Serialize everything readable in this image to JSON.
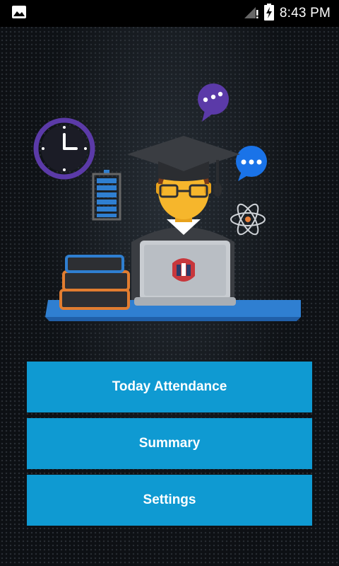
{
  "status_bar": {
    "time": "8:43 PM",
    "icons": [
      "image-notification-icon",
      "signal-icon",
      "battery-charging-icon"
    ]
  },
  "illustration": {
    "icons": [
      "clock-icon",
      "chat-bubble-icon",
      "battery-icon",
      "atom-icon",
      "graduate-icon",
      "laptop-icon",
      "books-icon"
    ],
    "colors": {
      "purple": "#5b3aa8",
      "blue": "#1a73e8",
      "desk": "#2f7fd1",
      "skin": "#f6b62c",
      "cap": "#3a3d42"
    }
  },
  "menu": {
    "today_label": "Today Attendance",
    "summary_label": "Summary",
    "settings_label": "Settings",
    "button_color": "#0f9ad2"
  }
}
